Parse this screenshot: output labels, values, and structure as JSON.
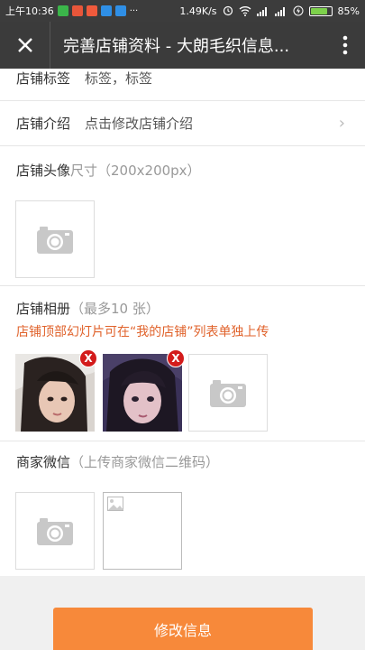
{
  "status_bar": {
    "time": "上午10:36",
    "network_speed": "1.49K/s",
    "battery_percent": "85%",
    "battery_level": 0.85
  },
  "header": {
    "title": "完善店铺资料 - 大朗毛织信息..."
  },
  "form": {
    "tags": {
      "label": "店铺标签",
      "value": "标签，标签"
    },
    "intro": {
      "label": "店铺介绍",
      "value": "点击修改店铺介绍"
    },
    "avatar": {
      "label": "店铺头像",
      "hint": "尺寸（200x200px）"
    },
    "album": {
      "label": "店铺相册",
      "hint": "（最多10 张）",
      "note": "店铺顶部幻灯片可在“我的店铺”列表单独上传",
      "remove_label": "X"
    },
    "wechat": {
      "label": "商家微信",
      "hint": "（上传商家微信二维码）"
    }
  },
  "footer": {
    "submit_label": "修改信息"
  },
  "colors": {
    "accent": "#f7893a",
    "note": "#e0622b",
    "remove_badge": "#d31b1b"
  }
}
